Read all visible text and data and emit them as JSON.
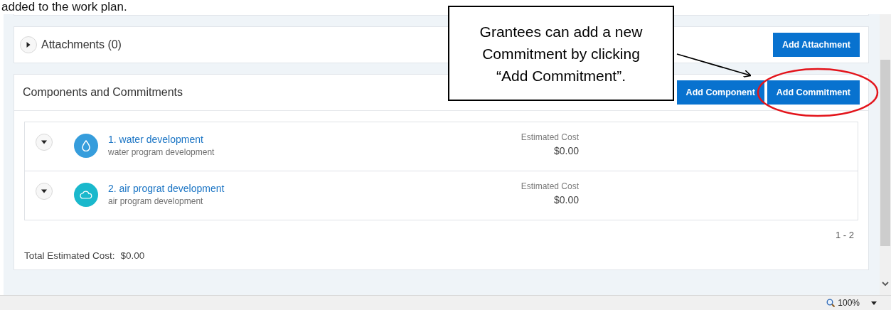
{
  "document_text": "added to the work plan.",
  "attachments": {
    "title": "Attachments (0)",
    "expanded": false,
    "button": "Add Attachment"
  },
  "components": {
    "title": "Components and Commitments",
    "buttons": [
      "Add Component",
      "Add Commitment"
    ],
    "items": [
      {
        "kind": "water",
        "color": "#369ddc",
        "title": "1. water development",
        "subtitle": "water program development",
        "cost_label": "Estimated Cost",
        "cost": "$0.00"
      },
      {
        "kind": "air",
        "color": "#1ab8cc",
        "title": "2. air prograt development",
        "subtitle": "air program development",
        "cost_label": "Estimated Cost",
        "cost": "$0.00"
      }
    ],
    "pagination": "1 - 2",
    "total_label": "Total Estimated Cost:",
    "total": "$0.00"
  },
  "callout": {
    "text": "Grantees can add a new Commitment by clicking “Add Commitment”."
  },
  "status_bar": {
    "zoom": "100%"
  }
}
